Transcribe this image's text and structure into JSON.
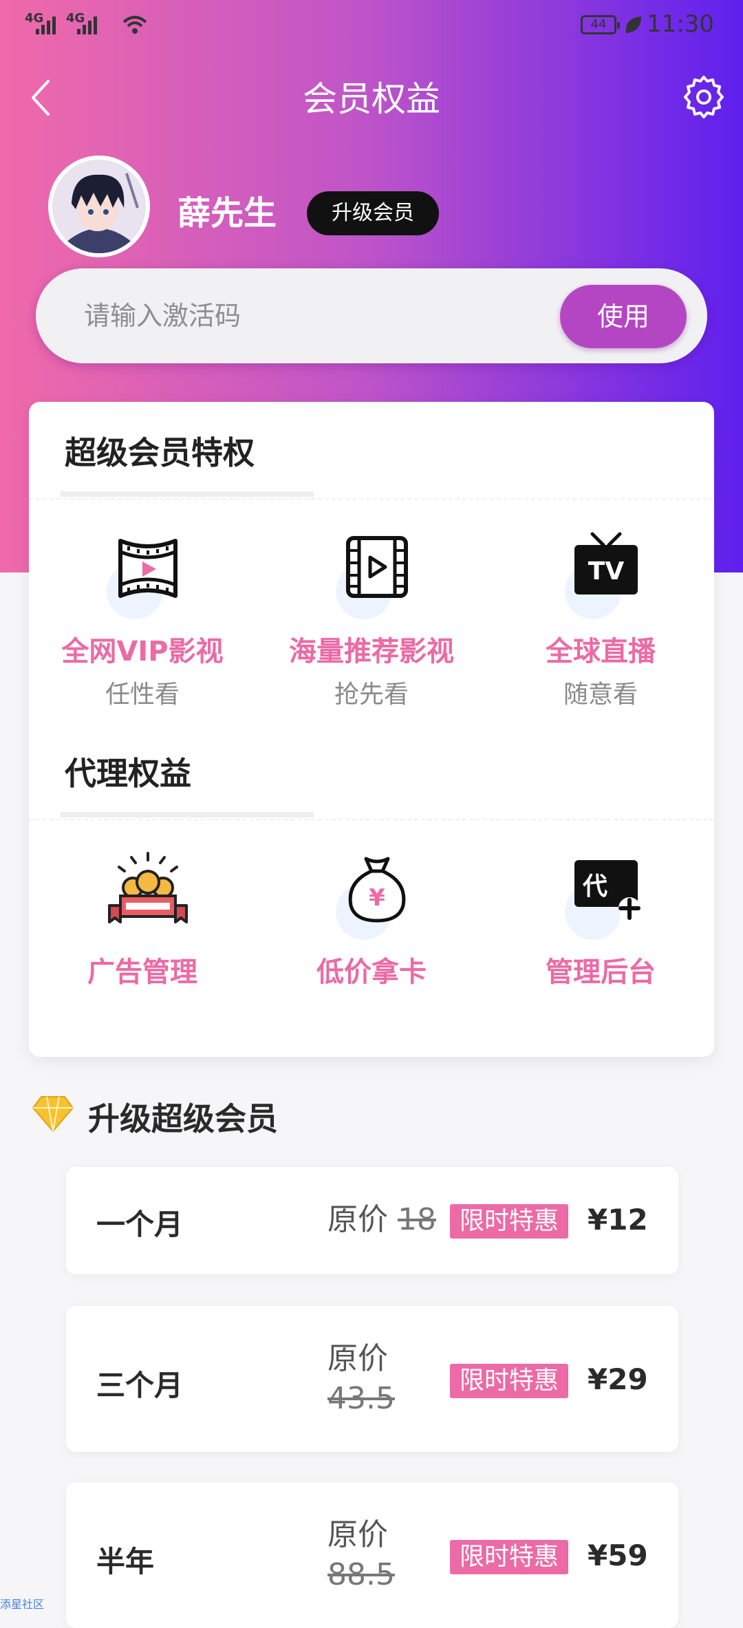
{
  "status_bar": {
    "signal1": "4G",
    "signal2": "4G",
    "battery": "44",
    "time": "11:30"
  },
  "header": {
    "title": "会员权益"
  },
  "user": {
    "name": "薛先生",
    "upgrade_label": "升级会员"
  },
  "activation": {
    "placeholder": "请输入激活码",
    "button_label": "使用"
  },
  "super_privileges": {
    "title": "超级会员特权",
    "items": [
      {
        "name": "全网VIP影视",
        "desc": "任性看",
        "icon": "film-reel-icon"
      },
      {
        "name": "海量推荐影视",
        "desc": "抢先看",
        "icon": "video-play-icon"
      },
      {
        "name": "全球直播",
        "desc": "随意看",
        "icon": "tv-icon"
      }
    ]
  },
  "agent_rights": {
    "title": "代理权益",
    "items": [
      {
        "name": "广告管理",
        "icon": "ad-banner-icon"
      },
      {
        "name": "低价拿卡",
        "icon": "money-bag-icon"
      },
      {
        "name": "管理后台",
        "icon": "agent-add-icon"
      }
    ],
    "agent_icon_text": "代"
  },
  "upgrade": {
    "title": "升级超级会员",
    "original_label": "原价",
    "plans": [
      {
        "name": "一个月",
        "original": "18",
        "tag": "限时特惠",
        "price": "¥12"
      },
      {
        "name": "三个月",
        "original": "43.5",
        "tag": "限时特惠",
        "price": "¥29"
      },
      {
        "name": "半年",
        "original": "88.5",
        "tag": "限时特惠",
        "price": "¥59"
      }
    ]
  },
  "watermark": "添星社区",
  "colors": {
    "accent_pink": "#ec6aa5",
    "accent_purple": "#b446c4",
    "gradient_start": "#f06aa9",
    "gradient_end": "#5f20ee"
  }
}
